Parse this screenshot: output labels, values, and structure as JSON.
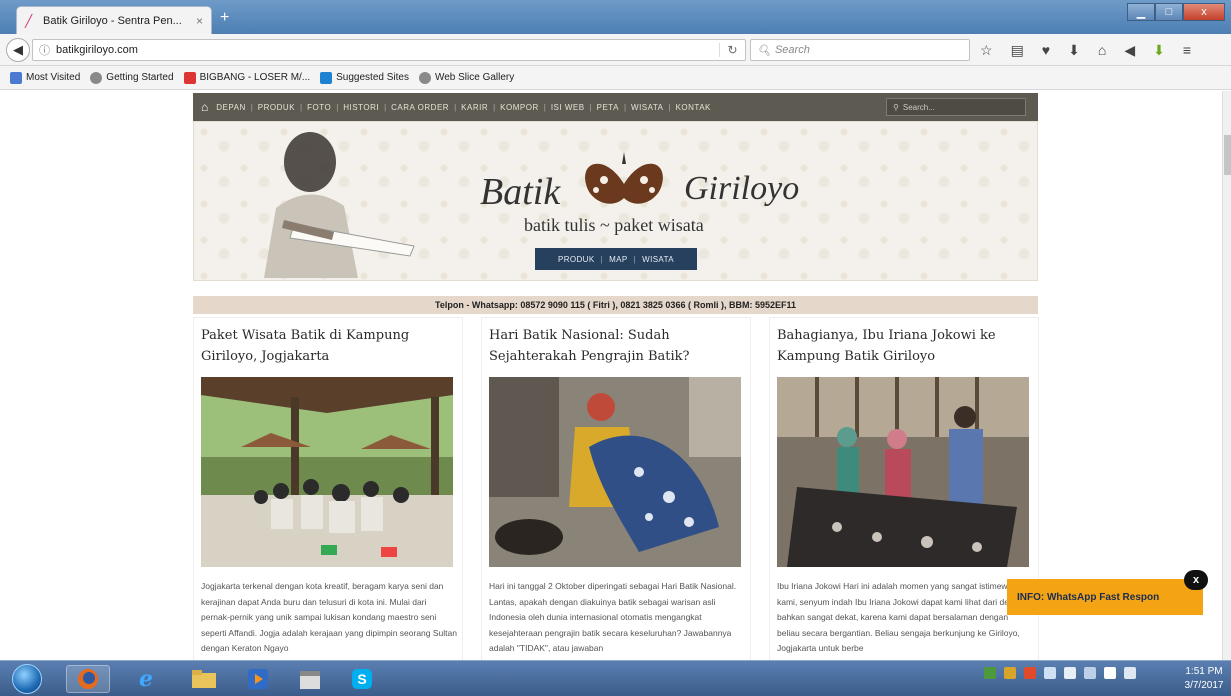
{
  "browser": {
    "tab_title": "Batik Giriloyo - Sentra Pen...",
    "tab_close": "×",
    "new_tab": "+",
    "url": "batikgiriloyo.com",
    "search_placeholder": "Search",
    "window_min": "▁",
    "window_max": "□",
    "window_close": "x"
  },
  "bookmarks": [
    {
      "label": "Most Visited",
      "color": "#4a7bd0"
    },
    {
      "label": "Getting Started",
      "color": "#8a8a8a"
    },
    {
      "label": "BIGBANG - LOSER M/...",
      "color": "#d33"
    },
    {
      "label": "Suggested Sites",
      "color": "#1e82d2"
    },
    {
      "label": "Web Slice Gallery",
      "color": "#8a8a8a"
    }
  ],
  "site": {
    "nav": [
      "DEPAN",
      "PRODUK",
      "FOTO",
      "HISTORI",
      "CARA ORDER",
      "KARIR",
      "KOMPOR",
      "ISI WEB",
      "PETA",
      "WISATA",
      "KONTAK"
    ],
    "search_placeholder": "Search...",
    "brand_left": "Batik",
    "brand_right": "Giriloyo",
    "tagline": "batik tulis ~ paket wisata",
    "subnav": [
      "PRODUK",
      "MAP",
      "WISATA"
    ],
    "phone": "Telpon - Whatsapp: 08572 9090 115 ( Fitri ), 0821 3825 0366 ( Romli ), BBM: 5952EF11"
  },
  "articles": [
    {
      "title": "Paket Wisata Batik di Kampung Giriloyo, Jogjakarta",
      "excerpt": "Jogjakarta terkenal dengan kota kreatif, beragam karya seni dan kerajinan dapat Anda buru dan telusuri di kota ini. Mulai dari pernak-pernik yang unik sampai lukisan kondang maestro seni seperti Affandi. Jogja adalah kerajaan yang dipimpin seorang Sultan dengan Keraton Ngayo"
    },
    {
      "title": "Hari Batik Nasional: Sudah Sejahterakah Pengrajin Batik?",
      "excerpt": "Hari ini tanggal 2 Oktober diperingati sebagai Hari Batik Nasional. Lantas, apakah dengan diakuinya batik sebagai warisan asli Indonesia oleh dunia internasional otomatis mengangkat kesejahteraan pengrajin batik secara keseluruhan? Jawabannya adalah \"TIDAK\", atau jawaban"
    },
    {
      "title": "Bahagianya, Ibu Iriana Jokowi ke Kampung Batik Giriloyo",
      "excerpt": "Ibu Iriana Jokowi Hari ini adalah momen yang sangat istimewa bagi kami, senyum indah Ibu Iriana Jokowi dapat kami lihat dari dekat, bahkan sangat dekat, karena kami dapat bersalaman dengan beliau secara bergantian. Beliau sengaja berkunjung ke Giriloyo, Jogjakarta untuk berbe"
    }
  ],
  "popup": {
    "text": "INFO: WhatsApp Fast Respon",
    "close": "x"
  },
  "taskbar": {
    "time": "1:51 PM",
    "date": "3/7/2017"
  }
}
